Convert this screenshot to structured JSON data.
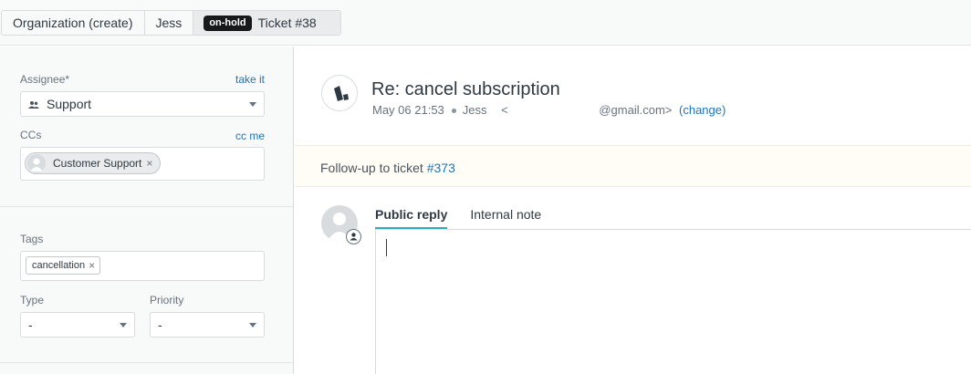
{
  "tabs": [
    {
      "label": "Organization (create)"
    },
    {
      "label": "Jess"
    },
    {
      "badge": "on-hold",
      "label": "Ticket #38"
    }
  ],
  "sidebar": {
    "assignee": {
      "label": "Assignee*",
      "link": "take it",
      "value": "Support",
      "icon": "people-icon"
    },
    "ccs": {
      "label": "CCs",
      "link": "cc me",
      "pill": "Customer Support",
      "remove": "×"
    },
    "tags": {
      "label": "Tags",
      "pill": "cancellation",
      "remove": "×"
    },
    "type": {
      "label": "Type",
      "value": "-"
    },
    "priority": {
      "label": "Priority",
      "value": "-"
    }
  },
  "ticket": {
    "subject": "Re: cancel subscription",
    "date": "May 06 21:53",
    "requester": "Jess",
    "email_prefix": "<",
    "email_suffix": "@gmail.com>",
    "change_link": "(change)",
    "followup_text": "Follow-up to ticket",
    "followup_link": "#373"
  },
  "reply": {
    "tabs": [
      {
        "label": "Public reply"
      },
      {
        "label": "Internal note"
      }
    ]
  },
  "colors": {
    "link": "#1f73b7",
    "active_tab_underline": "#30aabc",
    "badge_bg": "#17191a",
    "followup_bg": "#fffdf5"
  }
}
